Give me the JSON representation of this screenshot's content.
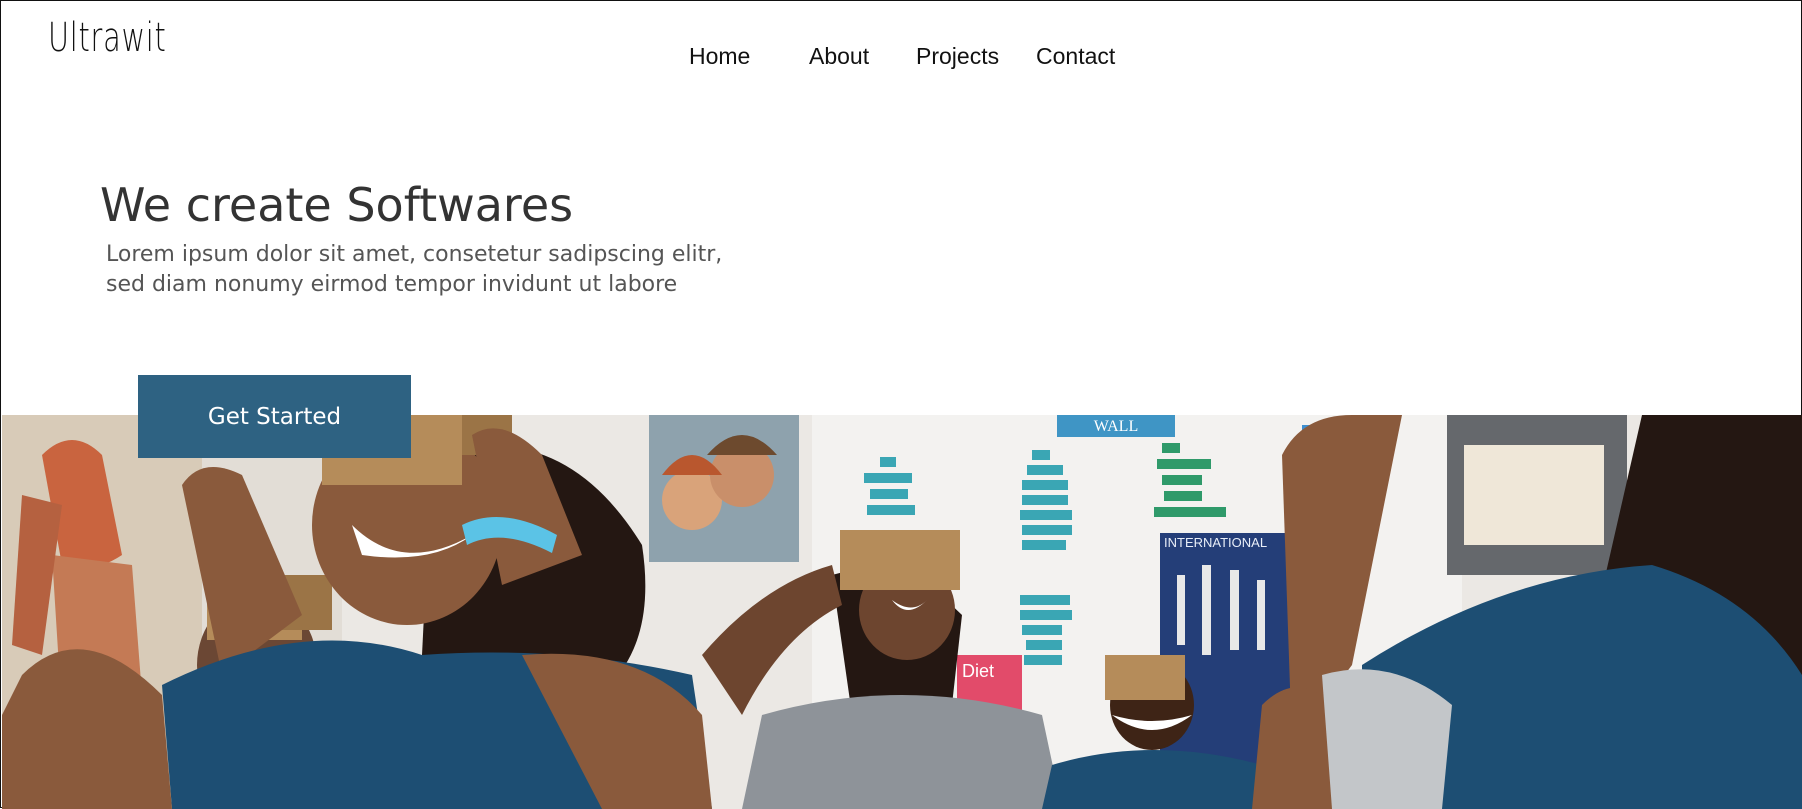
{
  "brand": {
    "logo_text": "Ultrawit"
  },
  "nav": {
    "items": [
      {
        "label": "Home"
      },
      {
        "label": "About"
      },
      {
        "label": "Projects"
      },
      {
        "label": "Contact"
      }
    ]
  },
  "hero": {
    "title": "We create Softwares",
    "text": "Lorem ipsum dolor sit amet, consetetur sadipscing elitr, sed diam nonumy eirmod tempor invidunt ut labore",
    "cta_label": "Get Started"
  },
  "banner": {
    "image": "students-wearing-cardboard-vr-viewers-photo",
    "wall_sign": "WALL",
    "poster_text": "INTERNATIONAL",
    "poster_diet": "Diet"
  },
  "colors": {
    "cta_bg": "#2e6282",
    "shirt_navy": "#1d4e73",
    "cardboard": "#b58c5a",
    "skin": "#6a4330"
  }
}
